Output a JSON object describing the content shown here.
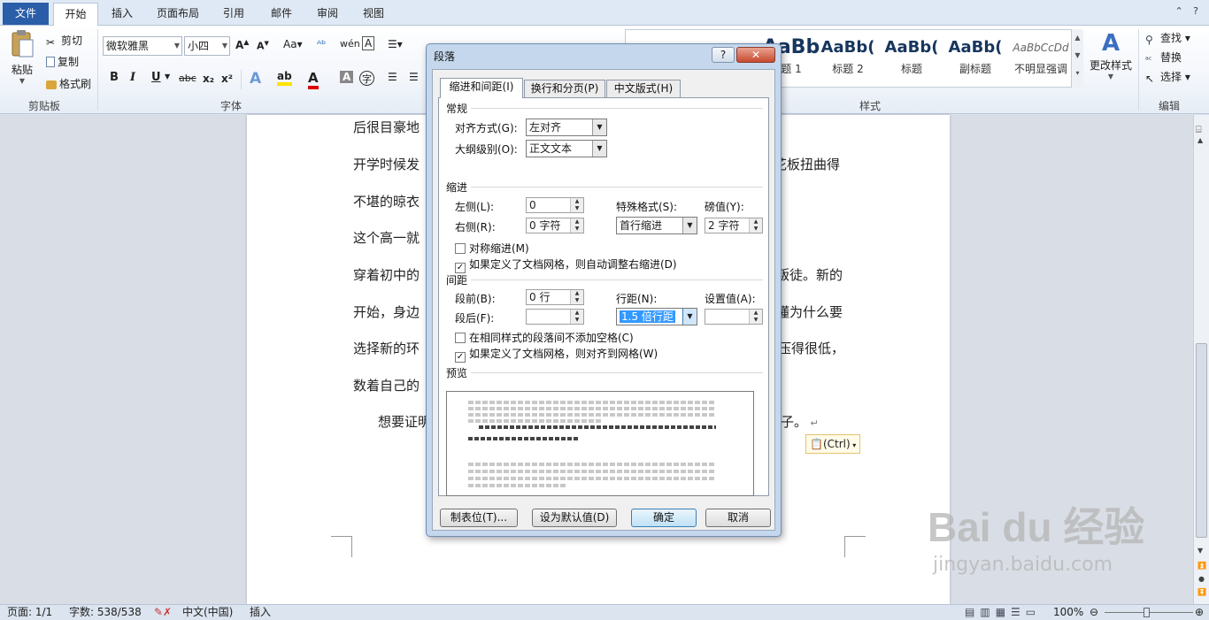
{
  "ribbon": {
    "tabs": {
      "file": "文件",
      "home": "开始",
      "insert": "插入",
      "page_layout": "页面布局",
      "references": "引用",
      "mailings": "邮件",
      "review": "审阅",
      "view": "视图"
    },
    "clipboard": {
      "paste": "粘贴",
      "cut": "剪切",
      "copy": "复制",
      "format_painter": "格式刷",
      "group_label": "剪贴板"
    },
    "font": {
      "name": "微软雅黑",
      "size": "小四",
      "bold": "B",
      "italic": "I",
      "underline": "U",
      "strikethrough": "abc",
      "subscript": "x₂",
      "superscript": "x²",
      "font_color_letter": "A",
      "group_label": "字体"
    },
    "styles": {
      "group_label": "样式",
      "items": [
        {
          "sample": "AaBb",
          "name": "题 1"
        },
        {
          "sample": "AaBb(",
          "name": "标题 2"
        },
        {
          "sample": "AaBb(",
          "name": "标题"
        },
        {
          "sample": "AaBb(",
          "name": "副标题"
        },
        {
          "sample": "AaBbCcDd",
          "name": "不明显强调"
        }
      ],
      "change_styles": "更改样式"
    },
    "editing": {
      "find": "查找",
      "replace": "替换",
      "select": "选择",
      "group_label": "编辑"
    }
  },
  "document": {
    "lines": [
      "后很目豪地",
      "开学时候发",
      "不堪的晾衣",
      "这个高一就",
      "穿着初中的",
      "开始，身边",
      "选择新的环",
      "数着自己的",
      "想要证明"
    ],
    "right_fragments": [
      "花板扭曲得",
      "叛徒。新的",
      "懂为什么要",
      "压得很低，",
      "子。"
    ],
    "paste_options": "(Ctrl)"
  },
  "dialog": {
    "title": "段落",
    "help": "?",
    "close": "✕",
    "tabs": [
      "缩进和间距(I)",
      "换行和分页(P)",
      "中文版式(H)"
    ],
    "general": {
      "section": "常规",
      "alignment_label": "对齐方式(G):",
      "alignment_value": "左对齐",
      "outline_label": "大纲级别(O):",
      "outline_value": "正文文本"
    },
    "indent": {
      "section": "缩进",
      "left_label": "左侧(L):",
      "left_value": "0",
      "right_label": "右侧(R):",
      "right_value": "0 字符",
      "special_label": "特殊格式(S):",
      "special_value": "首行缩进",
      "by_label": "磅值(Y):",
      "by_value": "2 字符",
      "mirror_label": "对称缩进(M)",
      "mirror_checked": false,
      "auto_adjust_label": "如果定义了文档网格，则自动调整右缩进(D)",
      "auto_adjust_checked": true
    },
    "spacing": {
      "section": "间距",
      "before_label": "段前(B):",
      "before_value": "0 行",
      "after_label": "段后(F):",
      "after_value": "",
      "line_spacing_label": "行距(N):",
      "line_spacing_value": "1.5 倍行距",
      "at_label": "设置值(A):",
      "at_value": "",
      "no_space_label": "在相同样式的段落间不添加空格(C)",
      "no_space_checked": false,
      "snap_grid_label": "如果定义了文档网格，则对齐到网格(W)",
      "snap_grid_checked": true
    },
    "preview": {
      "section": "预览"
    },
    "buttons": {
      "tabs": "制表位(T)...",
      "set_default": "设为默认值(D)",
      "ok": "确定",
      "cancel": "取消"
    }
  },
  "statusbar": {
    "page": "页面: 1/1",
    "words": "字数: 538/538",
    "language": "中文(中国)",
    "mode": "插入",
    "zoom": "100%"
  },
  "watermark": {
    "main": "Bai du 经验",
    "sub": "jingyan.baidu.com"
  }
}
